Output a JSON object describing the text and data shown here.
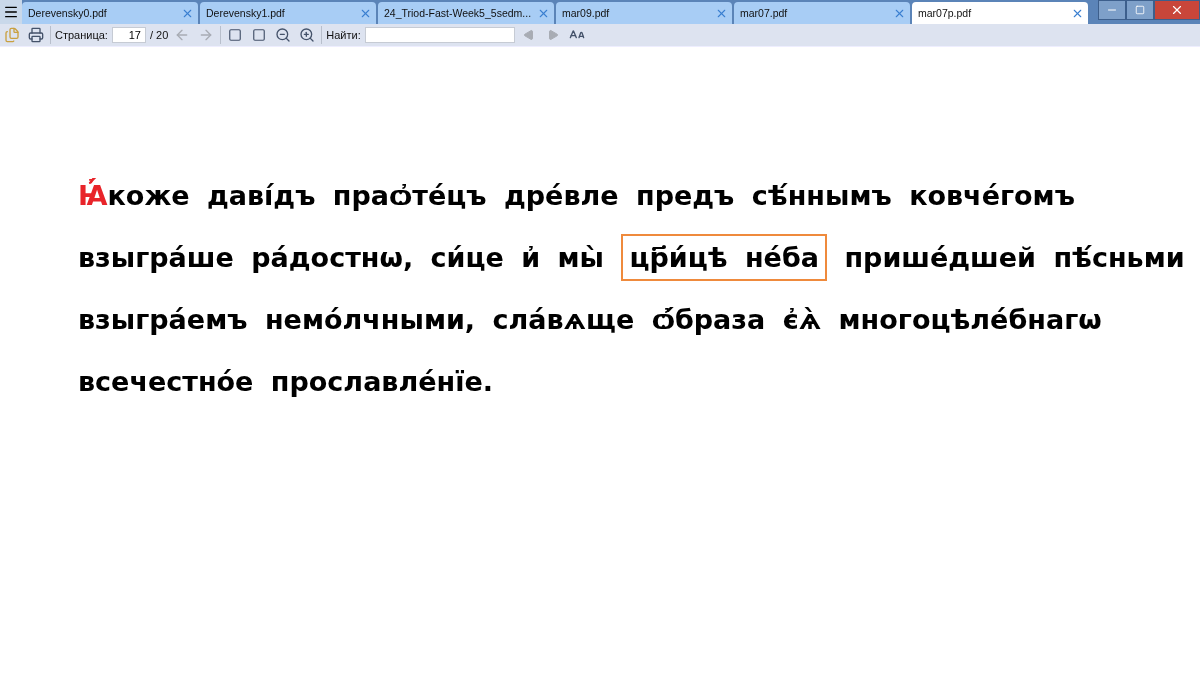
{
  "tabs": [
    {
      "label": "Derevensky0.pdf",
      "selected": false
    },
    {
      "label": "Derevensky1.pdf",
      "selected": false
    },
    {
      "label": "24_Triod-Fast-Week5_5sedm...",
      "selected": false
    },
    {
      "label": "mar09.pdf",
      "selected": false
    },
    {
      "label": "mar07.pdf",
      "selected": false
    },
    {
      "label": "mar07p.pdf",
      "selected": true
    }
  ],
  "toolbar": {
    "page_label": "Страница:",
    "page_value": "17",
    "page_total": "/ 20",
    "find_label": "Найти:"
  },
  "document": {
    "segments": [
      {
        "kind": "initial",
        "text": "Ꙗ҆́"
      },
      {
        "kind": "plain",
        "text": "коже даві́дъ праѻ҆те́цъ дре́вле предъ сѣ́ннымъ ковче́гомъ\nвзыгра́ше ра́достнѡ, си́це и҆ мы̀ "
      },
      {
        "kind": "highlight",
        "text": "цр҃и́цѣ не́ба"
      },
      {
        "kind": "plain",
        "text": " прише́дшей пѣ́сньми\nвзыгра́емъ немо́лчными, сла́вѧще ѻ҆́браза є҆ѧ̀ многоцѣле́бнагѡ\nвсечестно́е прославле́нїе."
      }
    ]
  }
}
